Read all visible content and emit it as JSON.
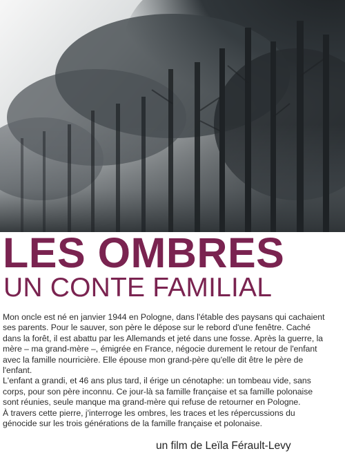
{
  "poster": {
    "title": "LES OMBRES",
    "subtitle": "UN CONTE FAMILIAL",
    "paragraphs": [
      "Mon oncle est né en janvier 1944 en Pologne, dans l'étable des paysans qui cachaient ses parents. Pour le sauver, son père le dépose sur le rebord d'une fenêtre. Caché dans la forêt, il est abattu par les Allemands et jeté dans une fosse. Après la guerre, la mère – ma grand-mère –, émigrée en France, négocie durement le retour de l'enfant avec la famille nourricière. Elle épouse mon grand-père qu'elle dit être le père de l'enfant.",
      "L'enfant a grandi, et 46 ans plus tard, il érige un cénotaphe: un tombeau vide, sans corps, pour son père inconnu. Ce jour-là sa famille française et sa famille polonaise sont réunies, seule manque ma grand-mère qui refuse de retourner en Pologne.",
      "À travers cette pierre, j'interroge les ombres, les traces et les répercussions du génocide sur les trois générations de la famille française et polonaise."
    ],
    "credit": "un film de Leïla Férault-Levy"
  },
  "colors": {
    "title": "#7a2350",
    "text": "#2a2a2a",
    "sky": "#eeeeee",
    "trees": "#2a2e30"
  }
}
